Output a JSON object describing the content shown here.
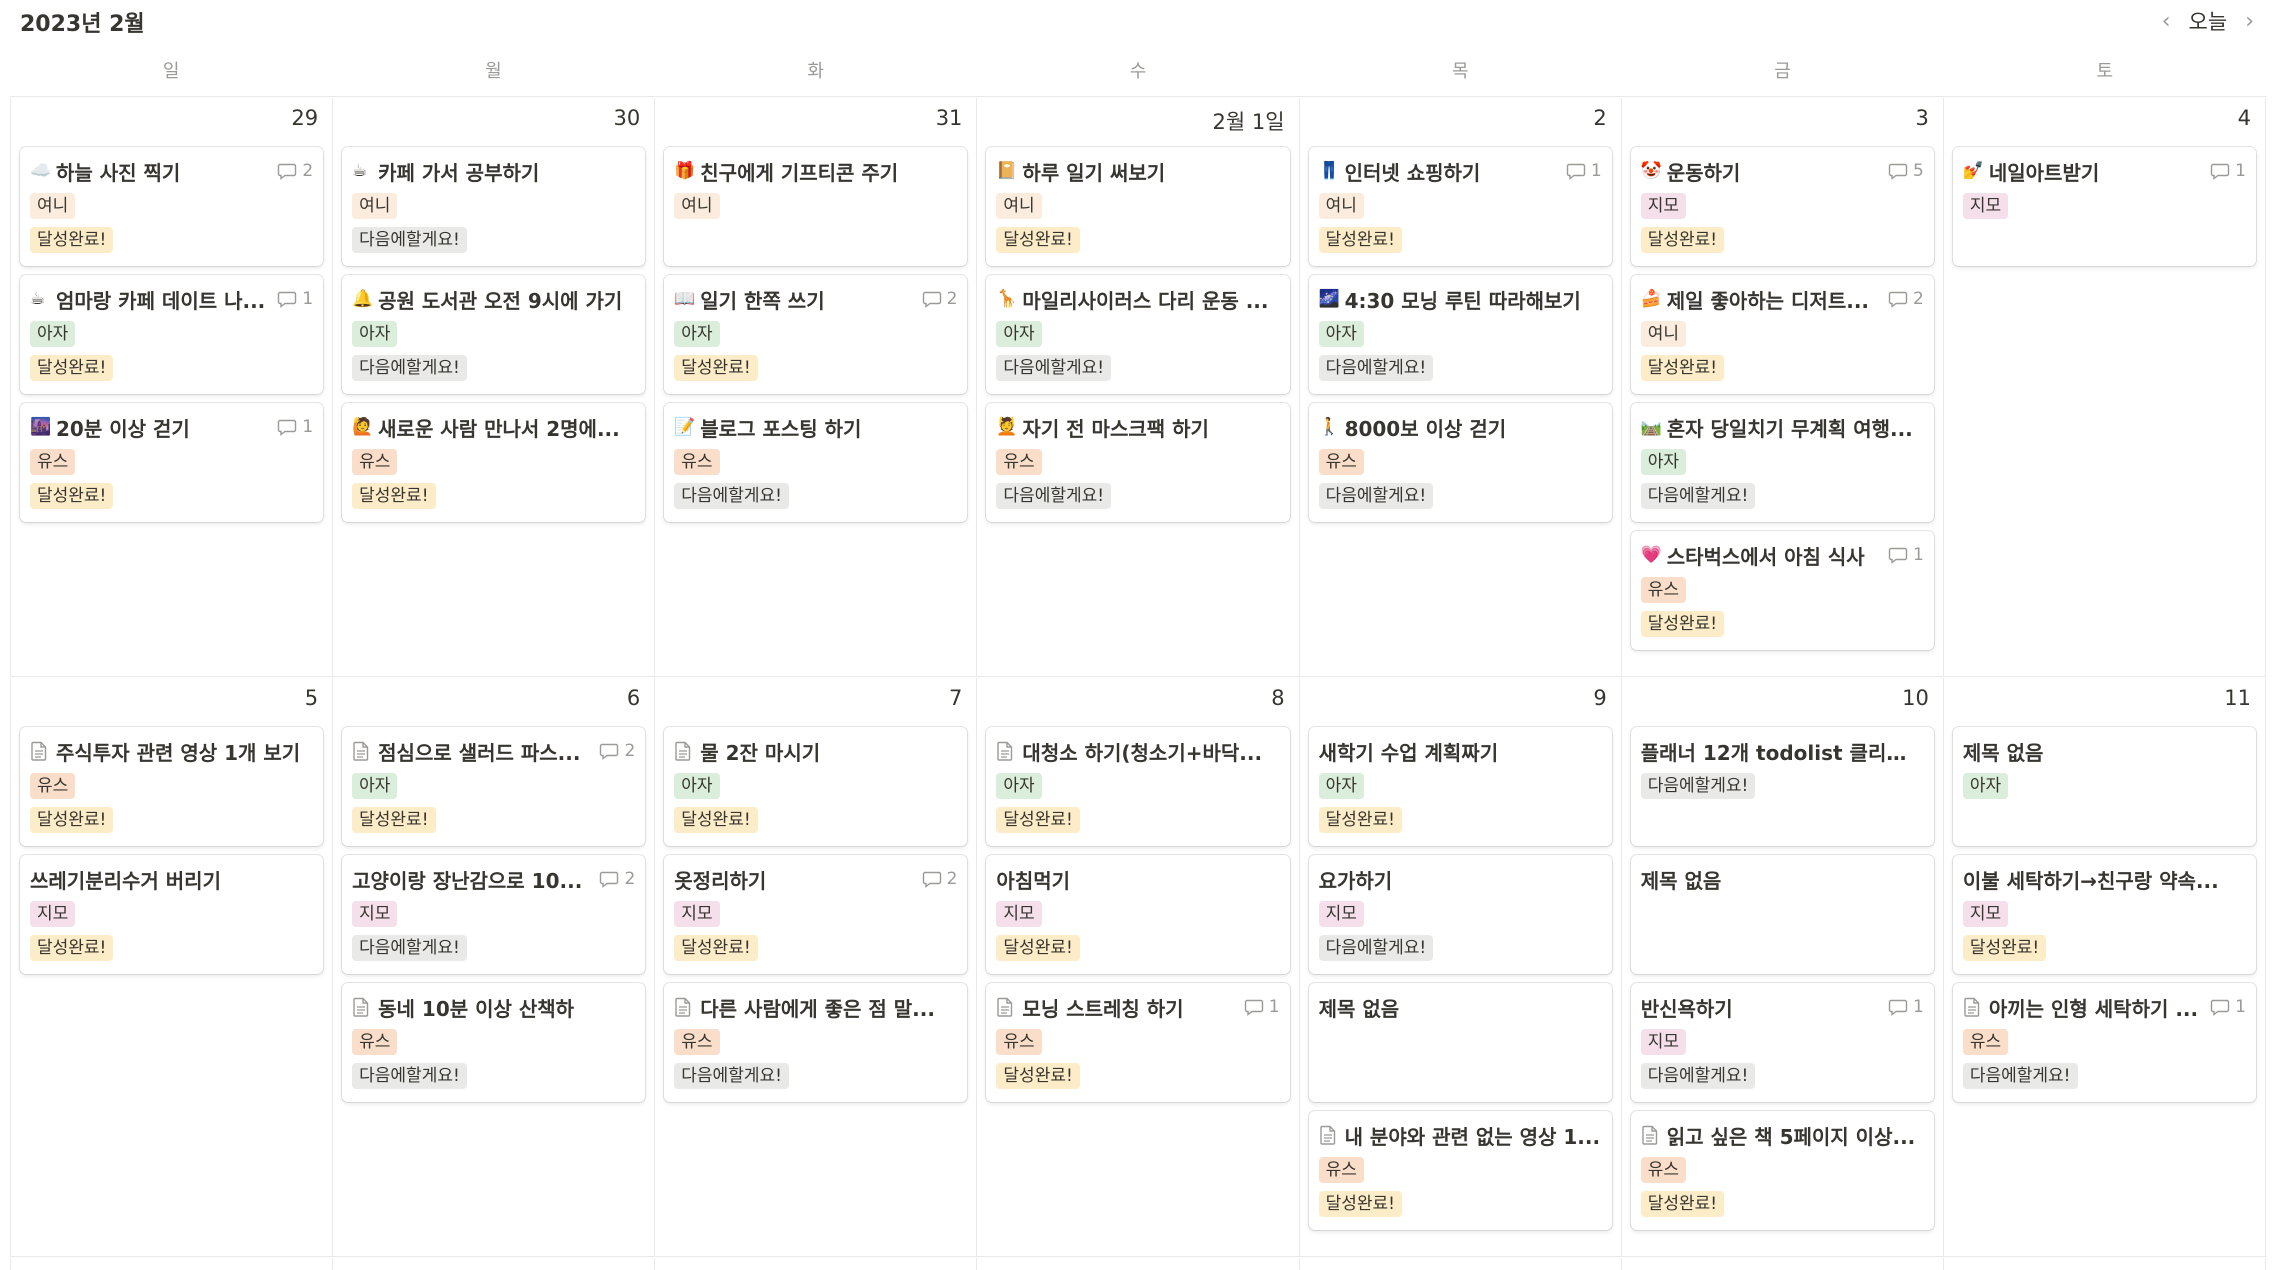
{
  "header": {
    "month_title": "2023년 2월",
    "prev_icon": "chevron-left-icon",
    "today_label": "오늘",
    "next_icon": "chevron-right-icon"
  },
  "weekdays": [
    "일",
    "월",
    "화",
    "수",
    "목",
    "금",
    "토"
  ],
  "colors": {
    "여니": "#fbecdd",
    "아자": "#dbeddb",
    "유스": "#fadec9",
    "지모": "#f4dfeb",
    "달성완료!": "#fdecc8",
    "다음에할게요!": "#e9e9e7"
  },
  "weeks": [
    {
      "days": [
        {
          "date": "29",
          "cards": [
            {
              "emoji": "☁️",
              "title": "하늘 사진 찍기",
              "comments": "2",
              "person": "여니",
              "status": "달성완료!"
            },
            {
              "emoji": "☕",
              "title": "엄마랑 카페 데이트 나...",
              "comments": "1",
              "person": "아자",
              "status": "달성완료!"
            },
            {
              "emoji": "🌆",
              "title": "20분 이상 걷기",
              "comments": "1",
              "person": "유스",
              "status": "달성완료!"
            }
          ]
        },
        {
          "date": "30",
          "cards": [
            {
              "emoji": "☕",
              "title": "카페 가서 공부하기",
              "person": "여니",
              "status": "다음에할게요!"
            },
            {
              "emoji": "🔔",
              "title": "공원 도서관 오전 9시에 가기",
              "person": "아자",
              "status": "다음에할게요!"
            },
            {
              "emoji": "🙋",
              "title": "새로운 사람 만나서 2명에...",
              "person": "유스",
              "status": "달성완료!"
            }
          ]
        },
        {
          "date": "31",
          "cards": [
            {
              "emoji": "🎁",
              "title": "친구에게 기프티콘 주기",
              "person": "여니"
            },
            {
              "emoji": "📖",
              "title": "일기 한쪽 쓰기",
              "comments": "2",
              "person": "아자",
              "status": "달성완료!"
            },
            {
              "emoji": "📝",
              "title": "블로그 포스팅 하기",
              "person": "유스",
              "status": "다음에할게요!"
            }
          ]
        },
        {
          "date": "2월 1일",
          "cards": [
            {
              "emoji": "📔",
              "title": "하루 일기 써보기",
              "person": "여니",
              "status": "달성완료!"
            },
            {
              "emoji": "🦒",
              "title": "마일리사이러스 다리 운동 ...",
              "person": "아자",
              "status": "다음에할게요!"
            },
            {
              "emoji": "💆",
              "title": "자기 전 마스크팩 하기",
              "person": "유스",
              "status": "다음에할게요!"
            }
          ]
        },
        {
          "date": "2",
          "cards": [
            {
              "emoji": "👖",
              "title": "인터넷 쇼핑하기",
              "comments": "1",
              "person": "여니",
              "status": "달성완료!"
            },
            {
              "emoji": "🌌",
              "title": "4:30 모닝 루틴 따라해보기",
              "person": "아자",
              "status": "다음에할게요!"
            },
            {
              "emoji": "🚶",
              "title": "8000보 이상 걷기",
              "person": "유스",
              "status": "다음에할게요!"
            }
          ]
        },
        {
          "date": "3",
          "cards": [
            {
              "emoji": "🤡",
              "title": "운동하기",
              "comments": "5",
              "person": "지모",
              "status": "달성완료!"
            },
            {
              "emoji": "🍰",
              "title": "제일 좋아하는 디저트...",
              "comments": "2",
              "person": "여니",
              "status": "달성완료!"
            },
            {
              "emoji": "🛤️",
              "title": "혼자 당일치기 무계획 여행...",
              "person": "아자",
              "status": "다음에할게요!"
            },
            {
              "emoji": "💗",
              "title": "스타벅스에서 아침 식사",
              "comments": "1",
              "person": "유스",
              "status": "달성완료!"
            }
          ]
        },
        {
          "date": "4",
          "cards": [
            {
              "emoji": "💅",
              "title": "네일아트받기",
              "comments": "1",
              "person": "지모"
            }
          ]
        }
      ]
    },
    {
      "days": [
        {
          "date": "5",
          "cards": [
            {
              "icon": "page-icon",
              "title": "주식투자 관련 영상 1개 보기",
              "person": "유스",
              "status": "달성완료!"
            },
            {
              "title": "쓰레기분리수거 버리기",
              "person": "지모",
              "status": "달성완료!"
            }
          ]
        },
        {
          "date": "6",
          "cards": [
            {
              "icon": "page-icon",
              "title": "점심으로 샐러드 파스...",
              "comments": "2",
              "person": "아자",
              "status": "달성완료!"
            },
            {
              "title": "고양이랑 장난감으로 10...",
              "comments": "2",
              "person": "지모",
              "status": "다음에할게요!"
            },
            {
              "icon": "page-icon",
              "title": "동네 10분 이상 산책하",
              "person": "유스",
              "status": "다음에할게요!"
            }
          ]
        },
        {
          "date": "7",
          "cards": [
            {
              "icon": "page-icon",
              "title": "물 2잔 마시기",
              "person": "아자",
              "status": "달성완료!"
            },
            {
              "title": "옷정리하기",
              "comments": "2",
              "person": "지모",
              "status": "달성완료!"
            },
            {
              "icon": "page-icon",
              "title": "다른 사람에게 좋은 점 말...",
              "person": "유스",
              "status": "다음에할게요!"
            }
          ]
        },
        {
          "date": "8",
          "cards": [
            {
              "icon": "page-icon",
              "title": "대청소 하기(청소기+바닥...",
              "person": "아자",
              "status": "달성완료!"
            },
            {
              "title": "아침먹기",
              "person": "지모",
              "status": "달성완료!"
            },
            {
              "icon": "page-icon",
              "title": "모닝 스트레칭 하기",
              "comments": "1",
              "person": "유스",
              "status": "달성완료!"
            }
          ]
        },
        {
          "date": "9",
          "cards": [
            {
              "title": "새학기 수업 계획짜기",
              "person": "아자",
              "status": "달성완료!"
            },
            {
              "title": "요가하기",
              "person": "지모",
              "status": "다음에할게요!"
            },
            {
              "title": "제목 없음"
            },
            {
              "icon": "page-icon",
              "title": "내 분야와 관련 없는 영상 1...",
              "person": "유스",
              "status": "달성완료!"
            }
          ]
        },
        {
          "date": "10",
          "cards": [
            {
              "title": "플래너 12개 todolist 클리어...",
              "status": "다음에할게요!"
            },
            {
              "title": "제목 없음"
            },
            {
              "title": "반신욕하기",
              "comments": "1",
              "person": "지모",
              "status": "다음에할게요!"
            },
            {
              "icon": "page-icon",
              "title": "읽고 싶은 책 5페이지 이상...",
              "person": "유스",
              "status": "달성완료!"
            }
          ]
        },
        {
          "date": "11",
          "cards": [
            {
              "title": "제목 없음",
              "person": "아자"
            },
            {
              "title": "이불 세탁하기→친구랑 약속...",
              "person": "지모",
              "status": "달성완료!"
            },
            {
              "icon": "page-icon",
              "title": "아끼는 인형 세탁하기 ...",
              "comments": "1",
              "person": "유스",
              "status": "다음에할게요!"
            }
          ]
        }
      ]
    }
  ]
}
